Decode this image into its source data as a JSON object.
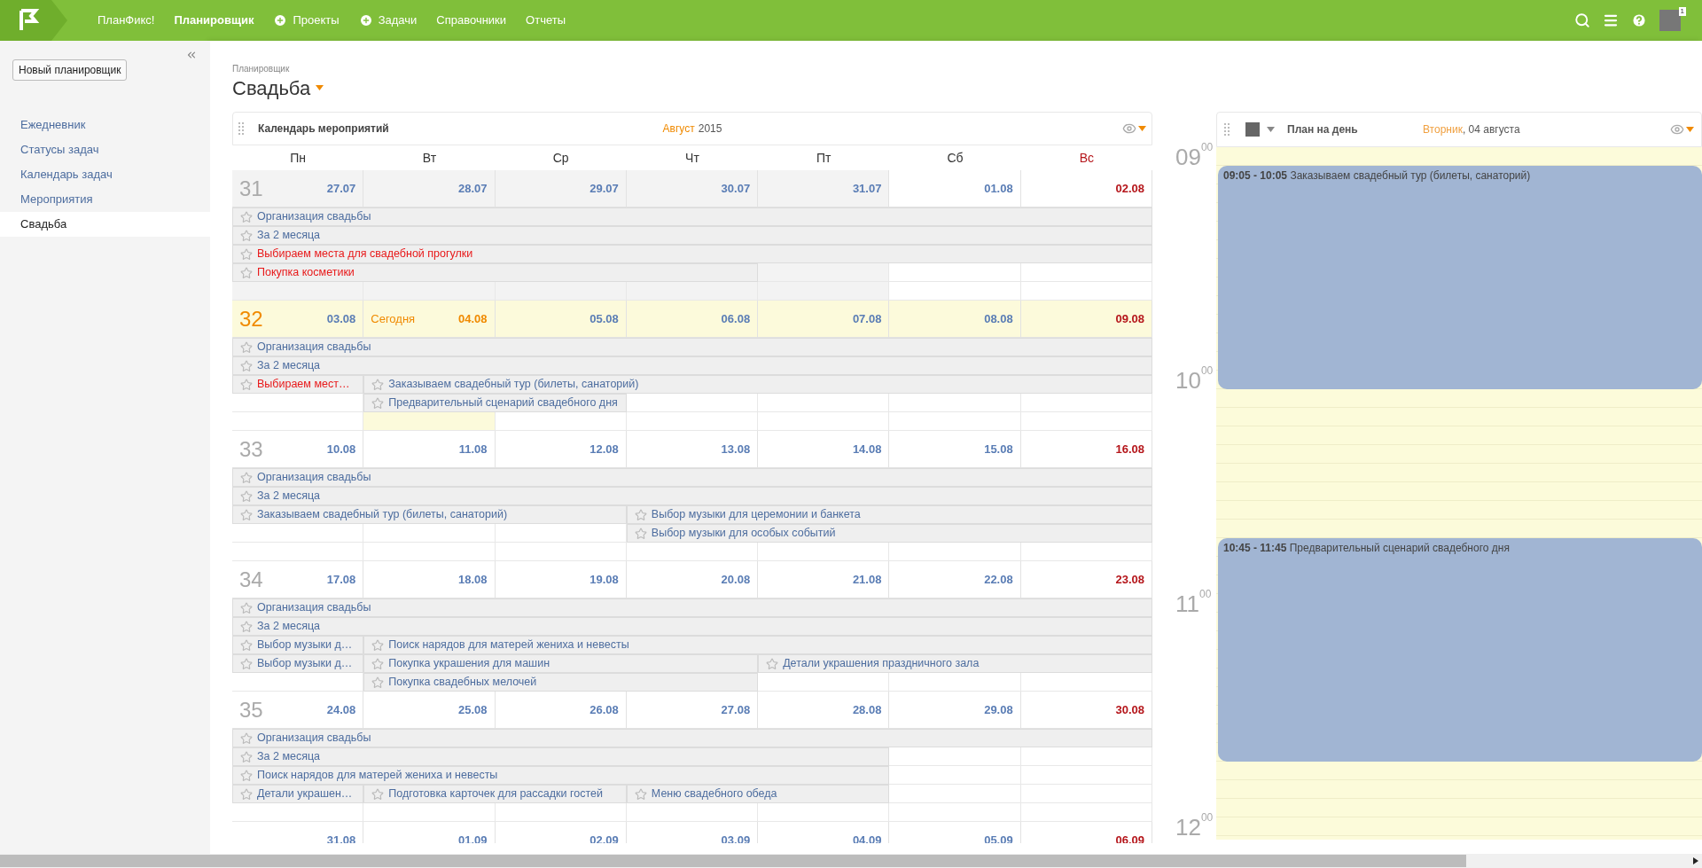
{
  "topbar": {
    "nav": [
      {
        "label": "ПланФикс!",
        "kind": "plain",
        "selected": false
      },
      {
        "label": "Планировщик",
        "kind": "plain",
        "selected": true
      },
      {
        "label": "Проекты",
        "kind": "plus",
        "selected": false
      },
      {
        "label": "Задачи",
        "kind": "plus",
        "selected": false
      },
      {
        "label": "Справочники",
        "kind": "plain",
        "selected": false
      },
      {
        "label": "Отчеты",
        "kind": "plain",
        "selected": false
      }
    ],
    "notifications": "1"
  },
  "sidebar": {
    "new_button": "Новый планировщик",
    "items": [
      {
        "label": "Ежедневник",
        "selected": false
      },
      {
        "label": "Статусы задач",
        "selected": false
      },
      {
        "label": "Календарь задач",
        "selected": false
      },
      {
        "label": "Мероприятия",
        "selected": false
      },
      {
        "label": "Свадьба",
        "selected": true
      }
    ]
  },
  "header": {
    "breadcrumb": "Планировщик",
    "title": "Свадьба"
  },
  "calendar": {
    "title": "Календарь мероприятий",
    "month": "Август",
    "year": "2015",
    "weekdays": [
      {
        "label": "Пн",
        "holiday": false
      },
      {
        "label": "Вт",
        "holiday": false
      },
      {
        "label": "Ср",
        "holiday": false
      },
      {
        "label": "Чт",
        "holiday": false
      },
      {
        "label": "Пт",
        "holiday": false
      },
      {
        "label": "Сб",
        "holiday": false
      },
      {
        "label": "Вс",
        "holiday": true
      }
    ],
    "weeks": [
      {
        "number": "31",
        "current": false,
        "days": [
          {
            "date": "27.07",
            "other_month": true,
            "today": false,
            "holiday": false
          },
          {
            "date": "28.07",
            "other_month": true,
            "today": false,
            "holiday": false
          },
          {
            "date": "29.07",
            "other_month": true,
            "today": false,
            "holiday": false
          },
          {
            "date": "30.07",
            "other_month": true,
            "today": false,
            "holiday": false
          },
          {
            "date": "31.07",
            "other_month": true,
            "today": false,
            "holiday": false
          },
          {
            "date": "01.08",
            "other_month": false,
            "today": false,
            "holiday": false
          },
          {
            "date": "02.08",
            "other_month": false,
            "today": false,
            "holiday": true
          }
        ],
        "lines": [
          [
            {
              "kind": "event",
              "title": "Организация свадьбы",
              "overdue": false
            },
            {
              "kind": "more"
            },
            {
              "kind": "more"
            },
            {
              "kind": "more"
            },
            {
              "kind": "more"
            },
            {
              "kind": "more"
            },
            {
              "kind": "more"
            }
          ],
          [
            {
              "kind": "event",
              "title": "За 2 месяца",
              "overdue": false
            },
            {
              "kind": "more"
            },
            {
              "kind": "more"
            },
            {
              "kind": "more"
            },
            {
              "kind": "more"
            },
            {
              "kind": "more"
            },
            {
              "kind": "more"
            }
          ],
          [
            {
              "kind": "event",
              "title": "Выбираем места для свадебной прогулки",
              "overdue": true
            },
            {
              "kind": "more"
            },
            {
              "kind": "more"
            },
            {
              "kind": "more"
            },
            {
              "kind": "more"
            },
            {
              "kind": "more"
            },
            {
              "kind": "more"
            }
          ],
          [
            {
              "kind": "event",
              "title": "Покупка косметики",
              "overdue": true
            },
            {
              "kind": "more"
            },
            {
              "kind": "more"
            },
            {
              "kind": "more"
            }
          ]
        ]
      },
      {
        "number": "32",
        "current": true,
        "days": [
          {
            "date": "03.08",
            "today": false,
            "holiday": false
          },
          {
            "date": "04.08",
            "today": true,
            "label": "Сегодня",
            "holiday": false
          },
          {
            "date": "05.08",
            "today": false,
            "holiday": false
          },
          {
            "date": "06.08",
            "today": false,
            "holiday": false
          },
          {
            "date": "07.08",
            "today": false,
            "holiday": false
          },
          {
            "date": "08.08",
            "today": false,
            "holiday": false
          },
          {
            "date": "09.08",
            "today": false,
            "holiday": true
          }
        ],
        "lines": [
          [
            {
              "kind": "event",
              "title": "Организация свадьбы",
              "overdue": false
            },
            {
              "kind": "more"
            },
            {
              "kind": "more"
            },
            {
              "kind": "more"
            },
            {
              "kind": "more"
            },
            {
              "kind": "more"
            },
            {
              "kind": "more"
            }
          ],
          [
            {
              "kind": "event",
              "title": "За 2 месяца",
              "overdue": false
            },
            {
              "kind": "more"
            },
            {
              "kind": "more"
            },
            {
              "kind": "more"
            },
            {
              "kind": "more"
            },
            {
              "kind": "more"
            },
            {
              "kind": "more"
            }
          ],
          [
            {
              "kind": "event",
              "title": "Выбираем мест…",
              "overdue": true
            },
            {
              "kind": "event",
              "title": "Заказываем свадебный тур (билеты, санаторий)",
              "overdue": false
            },
            {
              "kind": "more"
            },
            {
              "kind": "more"
            },
            {
              "kind": "more"
            },
            {
              "kind": "more"
            },
            {
              "kind": "more"
            }
          ],
          [
            {
              "kind": "empty"
            },
            {
              "kind": "event",
              "title": "Предварительный сценарий свадебного дня",
              "overdue": false
            },
            {
              "kind": "more"
            }
          ]
        ]
      },
      {
        "number": "33",
        "current": false,
        "days": [
          {
            "date": "10.08",
            "today": false,
            "holiday": false
          },
          {
            "date": "11.08",
            "today": false,
            "holiday": false
          },
          {
            "date": "12.08",
            "today": false,
            "holiday": false
          },
          {
            "date": "13.08",
            "today": false,
            "holiday": false
          },
          {
            "date": "14.08",
            "today": false,
            "holiday": false
          },
          {
            "date": "15.08",
            "today": false,
            "holiday": false
          },
          {
            "date": "16.08",
            "today": false,
            "holiday": true
          }
        ],
        "lines": [
          [
            {
              "kind": "event",
              "title": "Организация свадьбы",
              "overdue": false
            },
            {
              "kind": "more"
            },
            {
              "kind": "more"
            },
            {
              "kind": "more"
            },
            {
              "kind": "more"
            },
            {
              "kind": "more"
            },
            {
              "kind": "more"
            }
          ],
          [
            {
              "kind": "event",
              "title": "За 2 месяца",
              "overdue": false
            },
            {
              "kind": "more"
            },
            {
              "kind": "more"
            },
            {
              "kind": "more"
            },
            {
              "kind": "more"
            },
            {
              "kind": "more"
            },
            {
              "kind": "more"
            }
          ],
          [
            {
              "kind": "event",
              "title": "Заказываем свадебный тур (билеты, санаторий)",
              "overdue": false
            },
            {
              "kind": "more"
            },
            {
              "kind": "more"
            },
            {
              "kind": "event",
              "title": "Выбор музыки для церемонии и банкета",
              "overdue": false
            },
            {
              "kind": "more"
            },
            {
              "kind": "more"
            },
            {
              "kind": "more"
            }
          ],
          [
            {
              "kind": "empty"
            },
            {
              "kind": "empty"
            },
            {
              "kind": "empty"
            },
            {
              "kind": "event",
              "title": "Выбор музыки для особых событий",
              "overdue": false
            },
            {
              "kind": "more"
            },
            {
              "kind": "more"
            },
            {
              "kind": "more"
            }
          ]
        ]
      },
      {
        "number": "34",
        "current": false,
        "days": [
          {
            "date": "17.08",
            "today": false,
            "holiday": false
          },
          {
            "date": "18.08",
            "today": false,
            "holiday": false
          },
          {
            "date": "19.08",
            "today": false,
            "holiday": false
          },
          {
            "date": "20.08",
            "today": false,
            "holiday": false
          },
          {
            "date": "21.08",
            "today": false,
            "holiday": false
          },
          {
            "date": "22.08",
            "today": false,
            "holiday": false
          },
          {
            "date": "23.08",
            "today": false,
            "holiday": true
          }
        ],
        "lines": [
          [
            {
              "kind": "event",
              "title": "Организация свадьбы",
              "overdue": false
            },
            {
              "kind": "more"
            },
            {
              "kind": "more"
            },
            {
              "kind": "more"
            },
            {
              "kind": "more"
            },
            {
              "kind": "more"
            },
            {
              "kind": "more"
            }
          ],
          [
            {
              "kind": "event",
              "title": "За 2 месяца",
              "overdue": false
            },
            {
              "kind": "more"
            },
            {
              "kind": "more"
            },
            {
              "kind": "more"
            },
            {
              "kind": "more"
            },
            {
              "kind": "more"
            },
            {
              "kind": "more"
            }
          ],
          [
            {
              "kind": "event",
              "title": "Выбор музыки д…",
              "overdue": false
            },
            {
              "kind": "event",
              "title": "Поиск нарядов для матерей жениха и невесты",
              "overdue": false
            },
            {
              "kind": "more"
            },
            {
              "kind": "more"
            },
            {
              "kind": "more"
            },
            {
              "kind": "more"
            },
            {
              "kind": "more"
            }
          ],
          [
            {
              "kind": "event",
              "title": "Выбор музыки д…",
              "overdue": false
            },
            {
              "kind": "event",
              "title": "Покупка украшения для машин",
              "overdue": false
            },
            {
              "kind": "more"
            },
            {
              "kind": "more"
            },
            {
              "kind": "event",
              "title": "Детали украшения праздничного зала",
              "overdue": false
            },
            {
              "kind": "more"
            },
            {
              "kind": "more"
            }
          ],
          [
            {
              "kind": "empty"
            },
            {
              "kind": "event",
              "title": "Покупка свадебных мелочей",
              "overdue": false
            },
            {
              "kind": "more"
            },
            {
              "kind": "more"
            }
          ]
        ]
      },
      {
        "number": "35",
        "current": false,
        "days": [
          {
            "date": "24.08",
            "today": false,
            "holiday": false
          },
          {
            "date": "25.08",
            "today": false,
            "holiday": false
          },
          {
            "date": "26.08",
            "today": false,
            "holiday": false
          },
          {
            "date": "27.08",
            "today": false,
            "holiday": false
          },
          {
            "date": "28.08",
            "today": false,
            "holiday": false
          },
          {
            "date": "29.08",
            "today": false,
            "holiday": false
          },
          {
            "date": "30.08",
            "today": false,
            "holiday": true
          }
        ],
        "lines": [
          [
            {
              "kind": "event",
              "title": "Организация свадьбы",
              "overdue": false
            },
            {
              "kind": "more"
            },
            {
              "kind": "more"
            },
            {
              "kind": "more"
            },
            {
              "kind": "more"
            },
            {
              "kind": "more"
            },
            {
              "kind": "more"
            }
          ],
          [
            {
              "kind": "event",
              "title": "За 2 месяца",
              "overdue": false
            },
            {
              "kind": "more"
            },
            {
              "kind": "more"
            },
            {
              "kind": "more"
            },
            {
              "kind": "more"
            }
          ],
          [
            {
              "kind": "event",
              "title": "Поиск нарядов для матерей жениха и невесты",
              "overdue": false
            },
            {
              "kind": "more"
            },
            {
              "kind": "more"
            },
            {
              "kind": "more"
            },
            {
              "kind": "more"
            }
          ],
          [
            {
              "kind": "event",
              "title": "Детали украшен…",
              "overdue": false
            },
            {
              "kind": "event",
              "title": "Подготовка карточек для рассадки гостей",
              "overdue": false
            },
            {
              "kind": "more"
            },
            {
              "kind": "event",
              "title": "Меню свадебного обеда",
              "overdue": false
            },
            {
              "kind": "more"
            }
          ]
        ]
      },
      {
        "current": false,
        "days": [
          {
            "date": "31.08",
            "today": false,
            "holiday": false
          },
          {
            "date": "01.09",
            "today": false,
            "holiday": false
          },
          {
            "date": "02.09",
            "today": false,
            "holiday": false
          },
          {
            "date": "03.09",
            "today": false,
            "holiday": false
          },
          {
            "date": "04.09",
            "today": false,
            "holiday": false
          },
          {
            "date": "05.09",
            "today": false,
            "holiday": false
          },
          {
            "date": "06.09",
            "today": false,
            "holiday": true
          }
        ]
      }
    ]
  },
  "day_plan": {
    "title": "План на день",
    "weekday": "Вторник",
    "date": ", 04 августа",
    "hours": [
      "09$^{00}$",
      "10$^{00}$",
      "11$^{00}$",
      "12$^{00}$"
    ],
    "events": [
      {
        "time": "09:05 - 10:05",
        "title": "Заказываем свадебный тур (билеты, санаторий)"
      },
      {
        "time": "10:45 - 11:45",
        "title": "Предварительный сценарий свадебного дня"
      }
    ]
  }
}
